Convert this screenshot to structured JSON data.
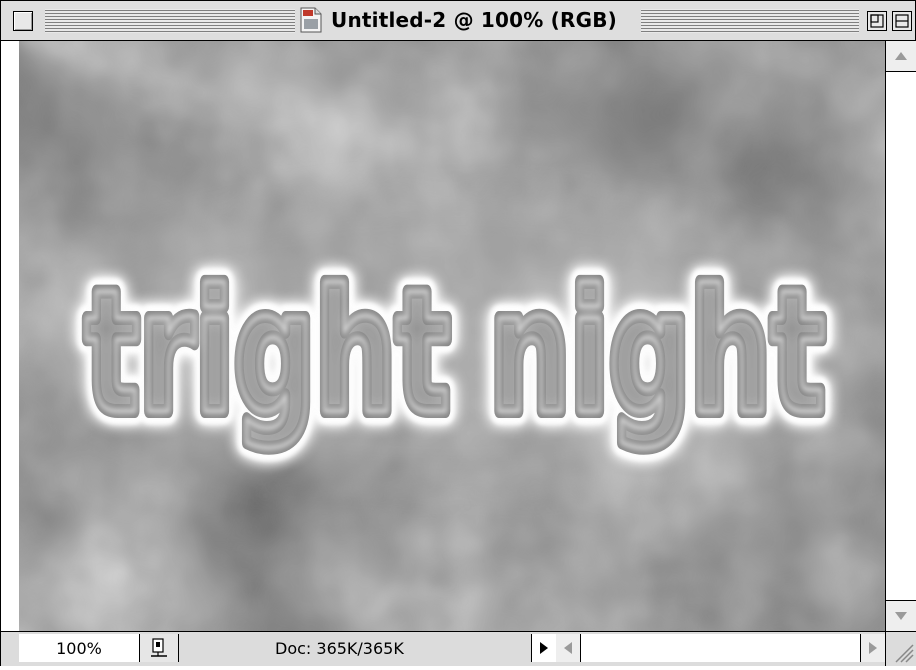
{
  "window": {
    "title": "Untitled-2 @ 100% (RGB)"
  },
  "canvas": {
    "artwork_text": "tright night"
  },
  "status": {
    "zoom": "100%",
    "doc_info": "Doc: 365K/365K"
  },
  "icons": {
    "close": "close-box-icon",
    "document": "document-icon",
    "zoom": "zoom-box-icon",
    "collapse": "collapse-box-icon",
    "scroll_up": "arrow-up-icon",
    "scroll_down": "arrow-down-icon",
    "scroll_left": "arrow-left-icon",
    "scroll_right": "arrow-right-icon",
    "preview": "page-preview-icon",
    "info_menu": "triangle-right-icon",
    "grow": "resize-grip-icon"
  },
  "colors": {
    "glow": "#ffffff",
    "background_dark": "#4a4a4a",
    "background_light": "#c8c8c8"
  }
}
